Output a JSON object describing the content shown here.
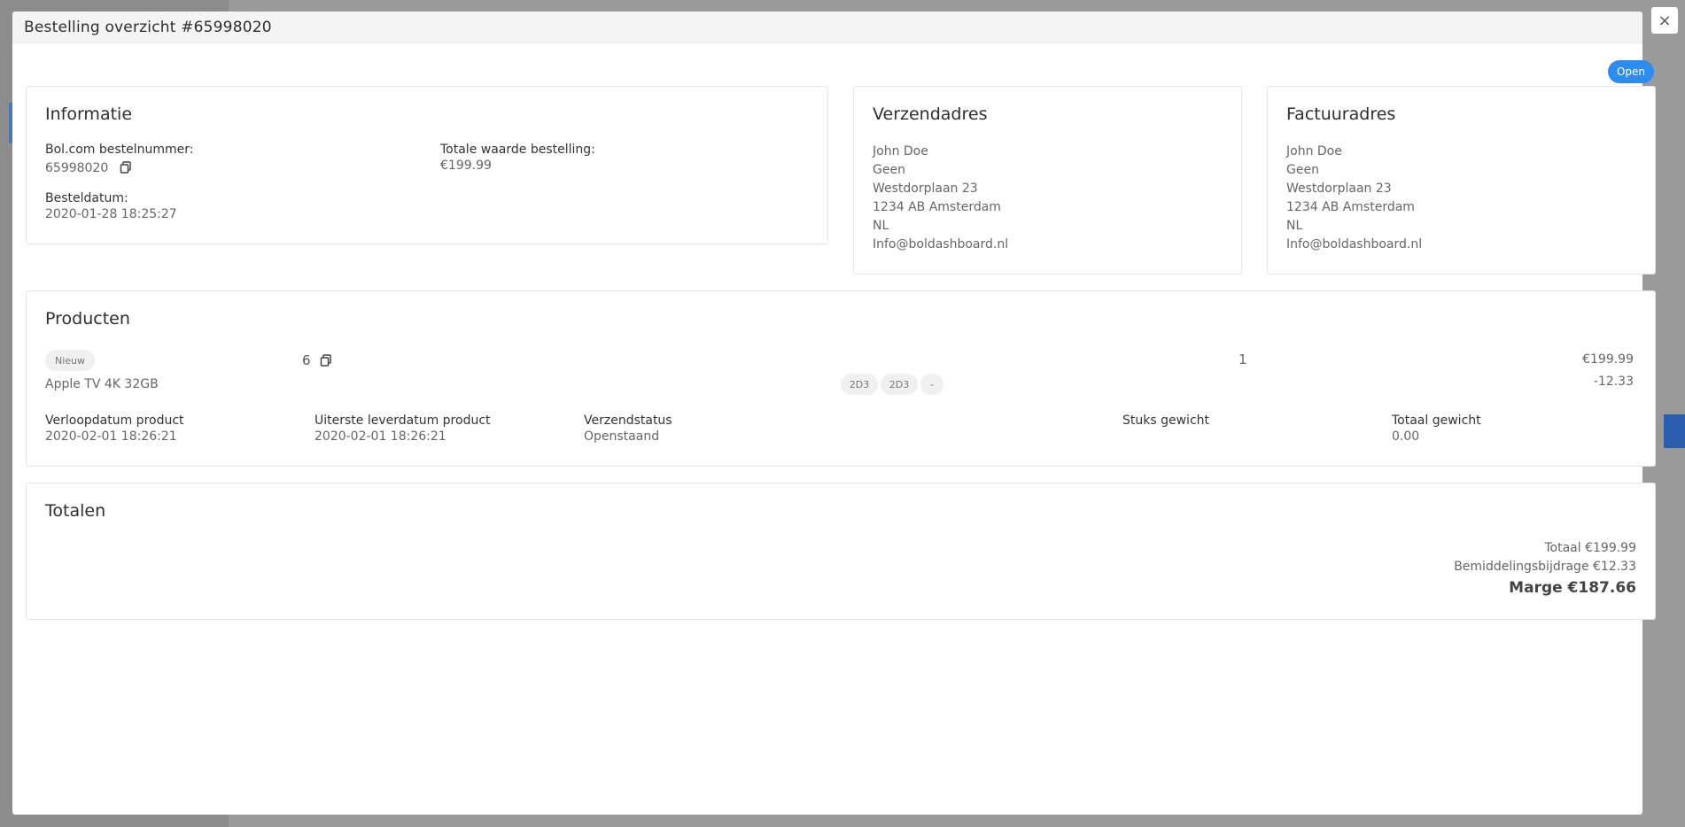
{
  "modal": {
    "title": "Bestelling overzicht #65998020",
    "close_label": "×",
    "status_badge": "Open"
  },
  "informatie": {
    "title": "Informatie",
    "order_number_label": "Bol.com bestelnummer:",
    "order_number": "65998020",
    "total_value_label": "Totale waarde bestelling:",
    "total_value": "€199.99",
    "order_date_label": "Besteldatum:",
    "order_date": "2020-01-28 18:25:27"
  },
  "shipping": {
    "title": "Verzendadres",
    "lines": [
      "John Doe",
      "Geen",
      "Westdorplaan 23",
      "1234 AB Amsterdam",
      "NL",
      "Info@boldashboard.nl"
    ]
  },
  "billing": {
    "title": "Factuuradres",
    "lines": [
      "John Doe",
      "Geen",
      "Westdorplaan 23",
      "1234 AB Amsterdam",
      "NL",
      "Info@boldashboard.nl"
    ]
  },
  "products": {
    "title": "Producten",
    "item": {
      "condition": "Nieuw",
      "id": "6",
      "name": "Apple TV 4K 32GB",
      "tags": [
        "2D3",
        "2D3",
        "-"
      ],
      "quantity": "1",
      "price": "€199.99",
      "commission": "-12.33",
      "expiry_label": "Verloopdatum product",
      "expiry_value": "2020-02-01 18:26:21",
      "latest_delivery_label": "Uiterste leverdatum product",
      "latest_delivery_value": "2020-02-01 18:26:21",
      "shipping_status_label": "Verzendstatus",
      "shipping_status_value": "Openstaand",
      "unit_weight_label": "Stuks gewicht",
      "total_weight_label": "Totaal gewicht",
      "total_weight_value": "0.00"
    }
  },
  "totals": {
    "title": "Totalen",
    "total": "Totaal €199.99",
    "commission": "Bemiddelingsbijdrage €12.33",
    "margin": "Marge €187.66"
  },
  "colors": {
    "accent": "#2d8cf0",
    "overlay": "#9a9a9a"
  }
}
